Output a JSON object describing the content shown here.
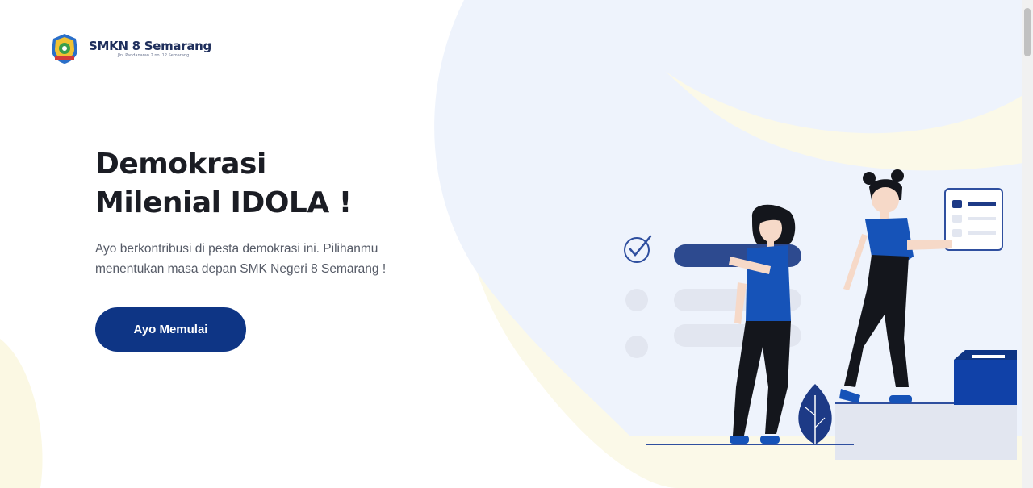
{
  "brand": {
    "name": "SMKN 8 Semarang",
    "tagline": "Jln. Pandanaran 2 no. 12 Semarang",
    "logo_icon": "school-emblem-icon"
  },
  "hero": {
    "title_line1": "Demokrasi",
    "title_line2": "Milenial IDOLA !",
    "description_line1": "Ayo berkontribusi di pesta demokrasi ini. Pilihanmu",
    "description_line2": "menentukan masa depan SMK Negeri 8 Semarang !",
    "cta_label": "Ayo Memulai"
  },
  "theme": {
    "primary": "#0e3585",
    "accent_blue": "#1851bf",
    "bg_blob_blue": "#eef3fc",
    "bg_blob_cream": "#fbf9e8",
    "text_dark": "#1b1d24",
    "text_muted": "#555a66"
  },
  "illustration": {
    "description_icons": [
      "checkmark-circle-icon",
      "ballot-card-icon",
      "ballot-box-icon",
      "leaf-icon"
    ]
  }
}
